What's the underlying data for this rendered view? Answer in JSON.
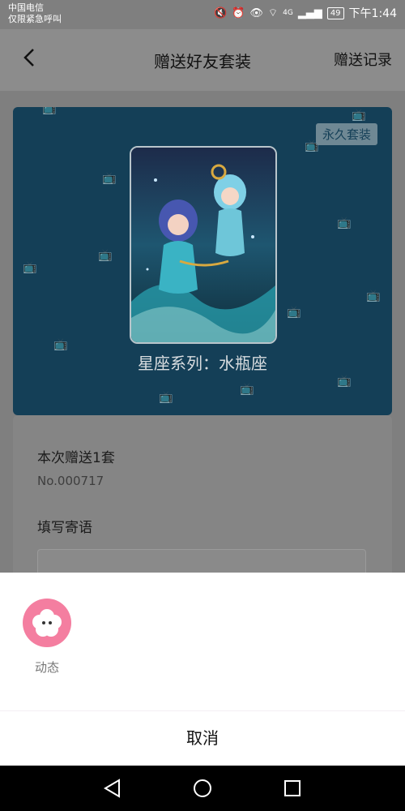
{
  "status_bar": {
    "carrier_line1": "中国电信",
    "carrier_line2": "仅限紧急呼叫",
    "battery": "49",
    "time": "下午1:44",
    "signal_4g": "4G"
  },
  "header": {
    "title": "赠送好友套装",
    "action": "赠送记录"
  },
  "card": {
    "tag": "永久套装",
    "title": "星座系列：水瓶座"
  },
  "form": {
    "gift_count": "本次赠送1套",
    "serial": "No.000717",
    "message_label": "填写寄语",
    "message_value": ""
  },
  "share_sheet": {
    "items": [
      {
        "label": "动态",
        "icon": "moments-icon"
      }
    ],
    "cancel_label": "取消"
  },
  "colors": {
    "card_bg": "#143f57",
    "accent_pink": "#f47ea0",
    "overlay": "#7f7f7f"
  }
}
